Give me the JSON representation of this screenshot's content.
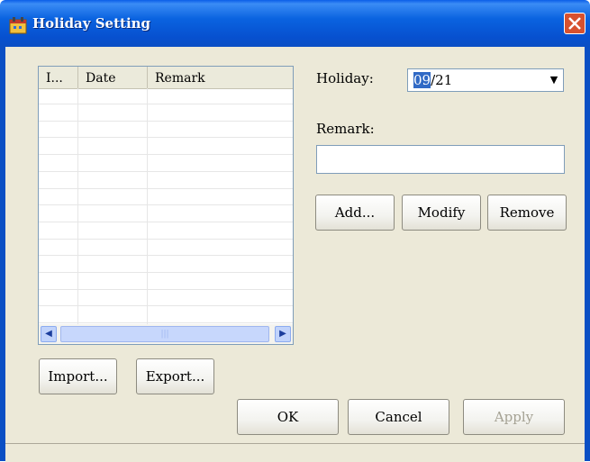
{
  "window": {
    "title": "Holiday Setting"
  },
  "list": {
    "columns": [
      "I...",
      "Date",
      "Remark"
    ],
    "rows": 14
  },
  "form": {
    "holiday_label": "Holiday:",
    "holiday_value_selected": "09",
    "holiday_value_rest": "/21",
    "remark_label": "Remark:",
    "remark_value": ""
  },
  "buttons": {
    "add": "Add...",
    "modify": "Modify",
    "remove": "Remove",
    "import": "Import...",
    "export": "Export...",
    "ok": "OK",
    "cancel": "Cancel",
    "apply": "Apply"
  },
  "colors": {
    "titlebar": "#0a5ee8",
    "close": "#d7512f",
    "dialog_bg": "#ece9d8"
  }
}
